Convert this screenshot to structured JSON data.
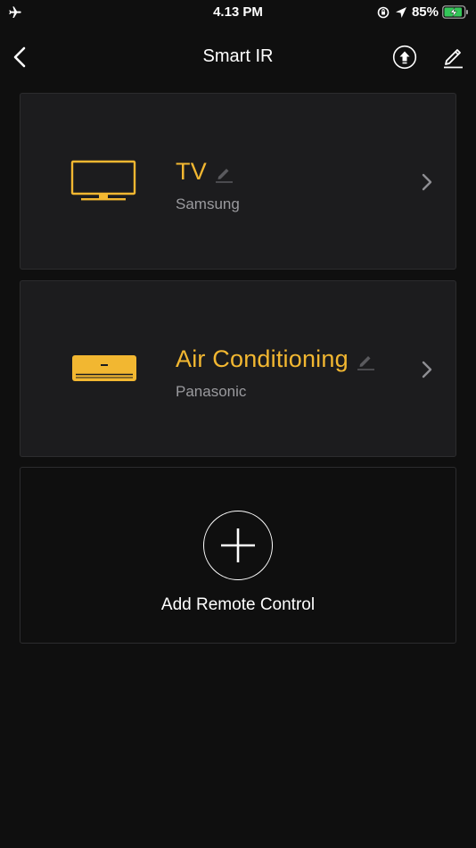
{
  "status_bar": {
    "time": "4.13 PM",
    "battery_percent": "85%",
    "icons": [
      "airplane-icon",
      "orientation-lock-icon",
      "location-arrow-icon",
      "battery-charging-icon"
    ]
  },
  "nav": {
    "title": "Smart IR",
    "icons": [
      "back-chevron-icon",
      "upload-icon",
      "edit-pencil-icon"
    ]
  },
  "remotes": [
    {
      "name": "TV",
      "brand": "Samsung",
      "icon": "tv-icon"
    },
    {
      "name": "Air Conditioning",
      "brand": "Panasonic",
      "icon": "air-conditioner-icon"
    }
  ],
  "add_remote": {
    "label": "Add Remote Control",
    "icon": "plus-circle-icon"
  },
  "colors": {
    "background": "#0f0f0f",
    "card": "#1c1c1e",
    "accent": "#f2b731",
    "secondary_text": "#9a9a9e"
  }
}
